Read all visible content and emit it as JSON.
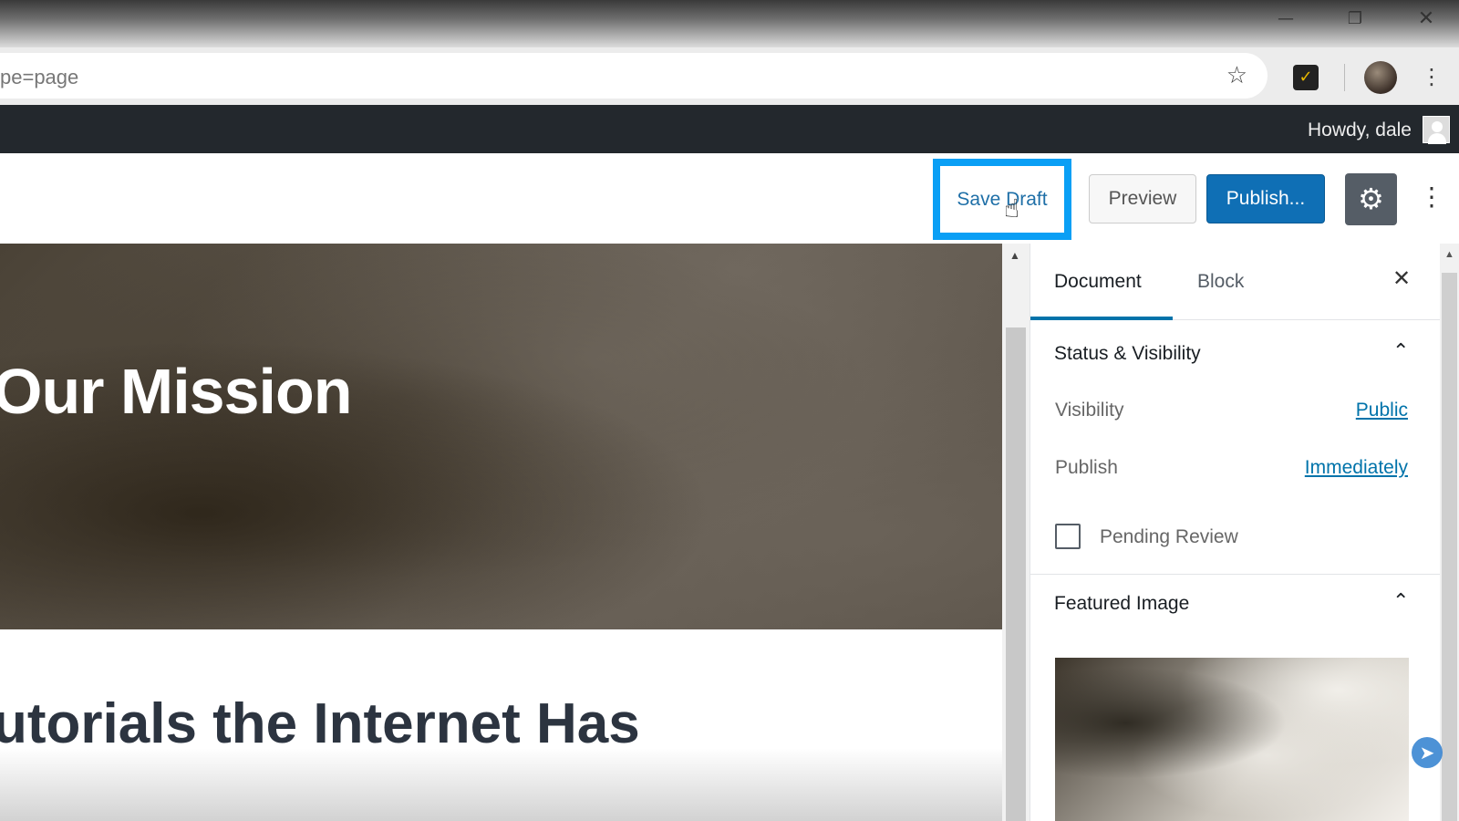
{
  "browser": {
    "url_fragment": "pe=page",
    "window_controls": {
      "minimize": "—",
      "maximize": "❐",
      "close": "✕"
    },
    "icons": {
      "bookmark": "star-icon",
      "extension": "checkmark-extension-icon",
      "menu": "kebab-icon"
    }
  },
  "admin_bar": {
    "greeting": "Howdy, dale"
  },
  "toolbar": {
    "save_draft_label": "Save Draft",
    "preview_label": "Preview",
    "publish_label": "Publish...",
    "highlight_color": "#0a9ff5",
    "publish_color": "#0f6fb5"
  },
  "content": {
    "cover_title": "Our Mission",
    "heading": "utorials the Internet Has"
  },
  "sidebar": {
    "tabs": [
      {
        "label": "Document",
        "active": true
      },
      {
        "label": "Block",
        "active": false
      }
    ],
    "status_panel": {
      "title": "Status & Visibility",
      "visibility_label": "Visibility",
      "visibility_value": "Public",
      "publish_label": "Publish",
      "publish_value": "Immediately",
      "pending_review_label": "Pending Review",
      "pending_review_checked": false
    },
    "featured_panel": {
      "title": "Featured Image"
    }
  }
}
